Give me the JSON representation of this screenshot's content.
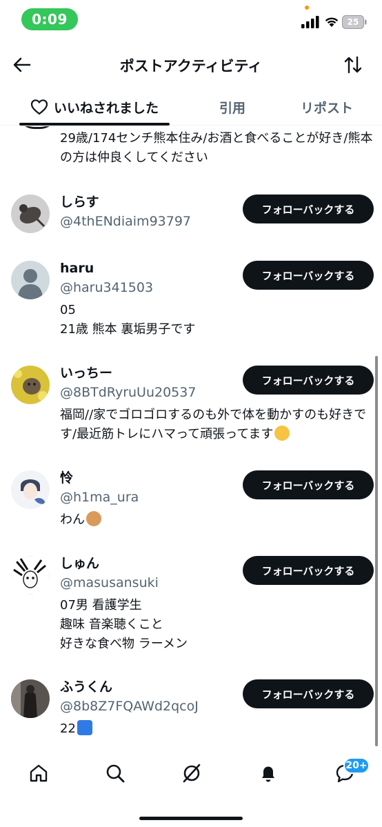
{
  "status": {
    "time": "0:09",
    "battery": "25"
  },
  "header": {
    "title": "ポストアクティビティ"
  },
  "tabs": [
    {
      "label": "いいねされました"
    },
    {
      "label": "引用"
    },
    {
      "label": "リポスト"
    }
  ],
  "partial_bio": "29歳/174センチ熊本住み/お酒と食べることが好き/熊本の方は仲良くしてください",
  "follow_label": "フォローバックする",
  "users": [
    {
      "name": "しらす",
      "handle": "@4thENdiaim93797",
      "bio": ""
    },
    {
      "name": "haru",
      "handle": "@haru341503",
      "bio": "05\n21歳 熊本 裏垢男子です"
    },
    {
      "name": "いっちー",
      "handle": "@8BTdRyruUu20537",
      "bio": "福岡//家でゴロゴロするのも外で体を動かすのも好きです/最近筋トレにハマって頑張ってます"
    },
    {
      "name": "怜",
      "handle": "@h1ma_ura",
      "bio": "わん"
    },
    {
      "name": "しゅん",
      "handle": "@masusansuki",
      "bio": "07男 看護学生\n趣味 音楽聴くこと\n好きな食べ物 ラーメン"
    },
    {
      "name": "ふうくん",
      "handle": "@8b8Z7FQAWd2qcoJ",
      "bio": "22"
    }
  ],
  "nav": {
    "badge": "20+",
    "icons": [
      "home-icon",
      "search-icon",
      "grok-icon",
      "notifications-icon",
      "messages-icon"
    ]
  },
  "colors": {
    "accent": "#1d9bf0",
    "button": "#0f1419",
    "time_pill": "#34c759",
    "secondary_text": "#536471"
  }
}
